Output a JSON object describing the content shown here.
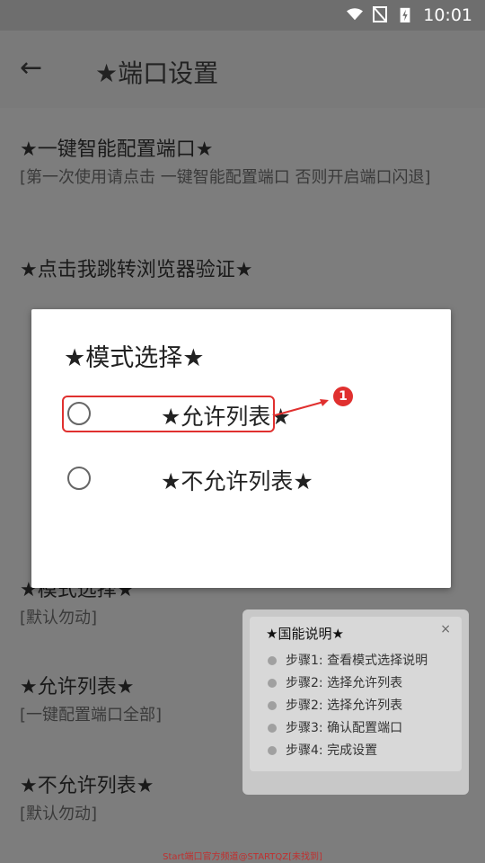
{
  "status_bar": {
    "time": "10:01",
    "icons": [
      "wifi-icon",
      "no-signal-icon",
      "battery-charging-icon"
    ]
  },
  "app_bar": {
    "back_icon": "arrow-left-icon",
    "title": "★端口设置"
  },
  "list": [
    {
      "title": "★一键智能配置端口★",
      "subtitle": "[第一次使用请点击 一键智能配置端口 否则开启端口闪退]"
    },
    {
      "title": "★点击我跳转浏览器验证★",
      "subtitle": ""
    },
    {
      "title": "★模式选择★",
      "subtitle": "[默认勿动]"
    },
    {
      "title": "★允许列表★",
      "subtitle": "[一键配置端口全部]"
    },
    {
      "title": "★不允许列表★",
      "subtitle": "[默认勿动]"
    }
  ],
  "dialog": {
    "title": "★模式选择★",
    "options": [
      {
        "label": "★允许列表★",
        "selected": false
      },
      {
        "label": "★不允许列表★",
        "selected": false
      }
    ]
  },
  "annotation": {
    "badge": "1",
    "color": "#e0302f"
  },
  "help_panel": {
    "title": "★国能说明★",
    "close": "×",
    "steps": [
      "步骤1: 查看模式选择说明",
      "步骤2: 选择允许列表",
      "步骤2: 选择允许列表",
      "步骤3: 确认配置端口",
      "步骤4: 完成设置"
    ]
  },
  "watermark": "Start端口官方频道@STARTQZ[未找到]"
}
